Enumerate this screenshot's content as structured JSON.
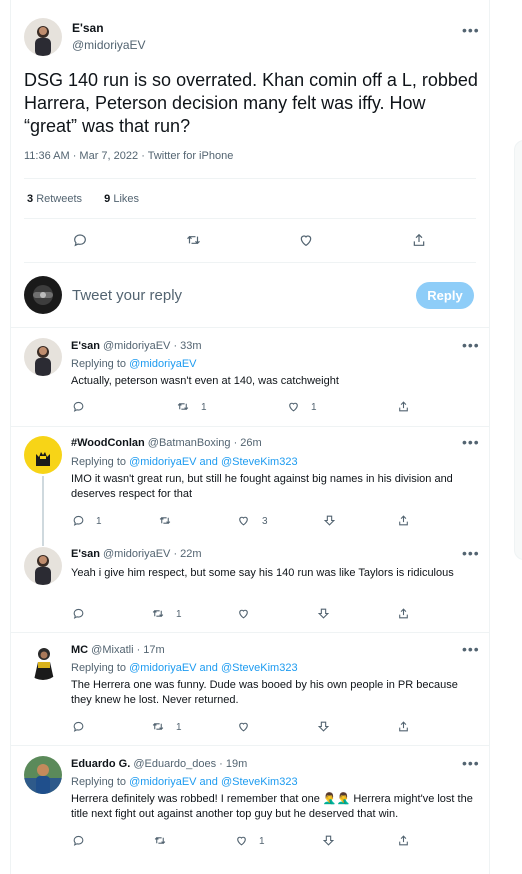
{
  "main_tweet": {
    "name": "E'san",
    "handle": "@midoriyaEV",
    "text": "DSG 140 run is so overrated. Khan comin off a L, robbed Harrera, Peterson decision many felt was iffy. How “great” was that run?",
    "meta": "11:36 AM · Mar 7, 2022 · Twitter for iPhone",
    "retweets_count": "3",
    "retweets_label": "Retweets",
    "likes_count": "9",
    "likes_label": "Likes"
  },
  "compose": {
    "placeholder": "Tweet your reply",
    "button_label": "Reply",
    "button_color": "#8ecdf8"
  },
  "replies": [
    {
      "name": "E'san",
      "handle": "@midoriyaEV · 33m",
      "replying_prefix": "Replying to ",
      "replying_to": "@midoriyaEV",
      "text": "Actually, peterson wasn't even at 140, was catchweight",
      "retweets": "1",
      "likes": "1"
    },
    {
      "name": "#WoodConlan",
      "handle": "@BatmanBoxing · 26m",
      "replying_prefix": "Replying to ",
      "replying_to": "@midoriyaEV and @SteveKim323",
      "text": "IMO it wasn't great run, but still he fought against big names in his division and deserves respect for that",
      "replies": "1",
      "likes": "3"
    },
    {
      "name": "E'san",
      "handle": "@midoriyaEV · 22m",
      "text": "Yeah i give him respect, but some say his 140 run was like Taylors is ridiculous",
      "retweets": "1"
    },
    {
      "name": "MC",
      "handle": "@Mixatli · 17m",
      "replying_prefix": "Replying to ",
      "replying_to": "@midoriyaEV and @SteveKim323",
      "text": "The Herrera one was funny. Dude was booed by his own people in PR because they knew he lost. Never returned.",
      "retweets": "1"
    },
    {
      "name": "Eduardo G.",
      "handle": "@Eduardo_does · 19m",
      "replying_prefix": "Replying to ",
      "replying_to": "@midoriyaEV and @SteveKim323",
      "text": "Herrera definitely was robbed! I remember that one 🤦‍♂️🤦‍♂️ Herrera might've lost the title next fight out against another top guy but he deserved that win.",
      "likes": "1"
    }
  ],
  "colors": {
    "accent": "#1d9bf0",
    "muted": "#536471",
    "divider": "#eff3f4"
  },
  "icons": [
    "more-icon",
    "reply-icon",
    "retweet-icon",
    "like-icon",
    "share-icon",
    "downvote-icon"
  ]
}
